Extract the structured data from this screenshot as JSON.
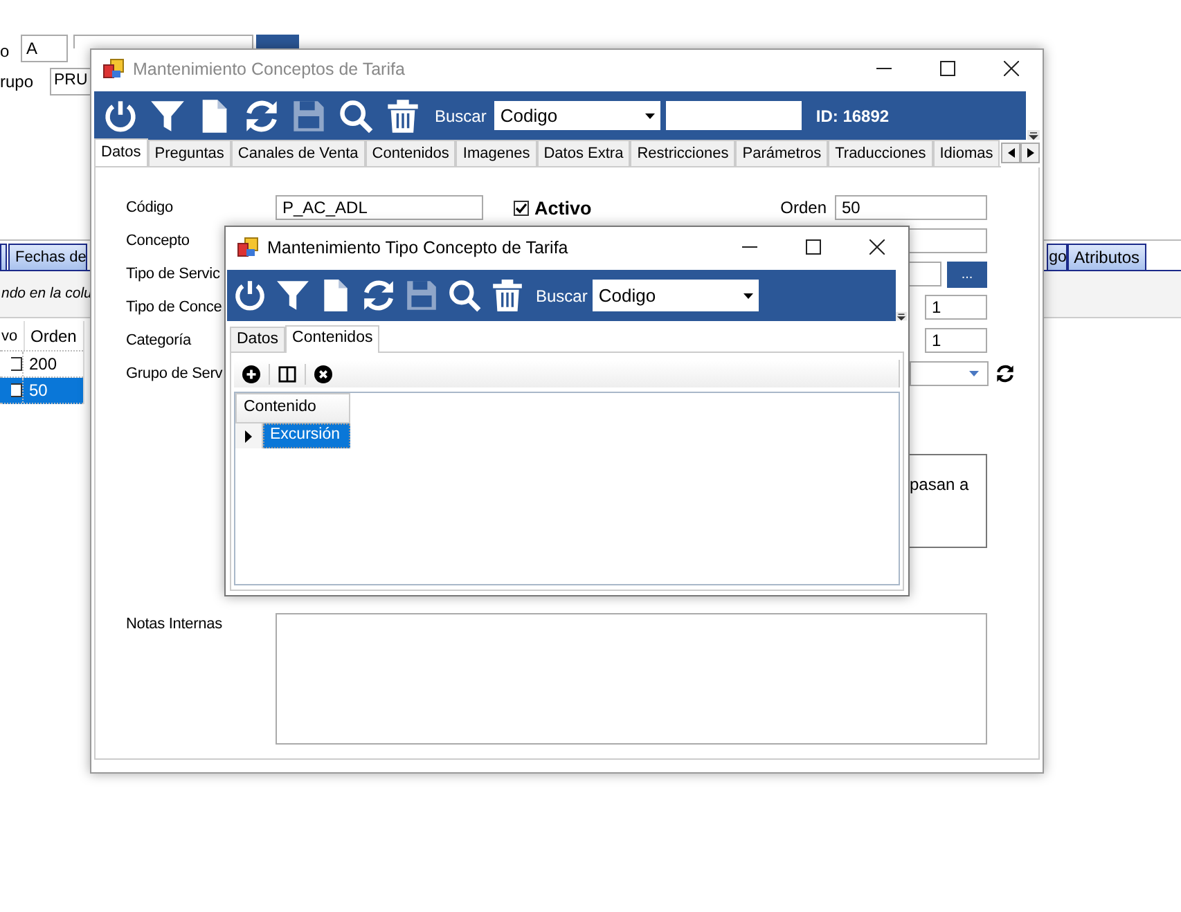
{
  "background_window": {
    "label_1": "o",
    "field_1": "A",
    "label_2": "rupo",
    "field_3": "PRU",
    "tabs_left": [
      {
        "label": "Fechas de",
        "selected": false
      }
    ],
    "tabs_right": [
      {
        "label": "go",
        "selected": false
      },
      {
        "label": "Atributos",
        "selected": false
      }
    ],
    "hint": "ndo en la colu",
    "grid": {
      "columns": [
        "vo",
        "Orden"
      ],
      "rows": [
        {
          "checked": false,
          "orden": "200",
          "selected": false
        },
        {
          "checked": false,
          "orden": "50",
          "selected": true
        }
      ]
    }
  },
  "window_1": {
    "title": "Mantenimiento Conceptos de Tarifa",
    "active": false,
    "toolbar": {
      "buttons": [
        {
          "kind": "power",
          "disabled": false
        },
        {
          "kind": "filter",
          "disabled": false
        },
        {
          "kind": "new",
          "disabled": false
        },
        {
          "kind": "refresh",
          "disabled": false
        },
        {
          "kind": "save",
          "disabled": true
        },
        {
          "kind": "search",
          "disabled": false
        },
        {
          "kind": "delete",
          "disabled": false
        }
      ],
      "search_label": "Buscar",
      "search_by": "Codigo",
      "id_label": "ID: 16892"
    },
    "tabs": [
      {
        "label": "Datos",
        "selected": true
      },
      {
        "label": "Preguntas",
        "selected": false
      },
      {
        "label": "Canales de Venta",
        "selected": false
      },
      {
        "label": "Contenidos",
        "selected": false
      },
      {
        "label": "Imagenes",
        "selected": false
      },
      {
        "label": "Datos Extra",
        "selected": false
      },
      {
        "label": "Restricciones",
        "selected": false
      },
      {
        "label": "Parámetros",
        "selected": false
      },
      {
        "label": "Traducciones",
        "selected": false
      },
      {
        "label": "Idiomas",
        "selected": false
      }
    ],
    "form": {
      "codigo_label": "Código",
      "codigo": "P_AC_ADL",
      "activo": {
        "label": "Activo",
        "checked": true
      },
      "orden_label": "Orden",
      "orden": "50",
      "labels": [
        "Concepto",
        "Tipo de Servic",
        "Tipo de Conce",
        "Categoría",
        "Grupo de Serv"
      ],
      "browse_button": "...",
      "value_1": "1",
      "value_2": "1",
      "note": "pasan a",
      "notas_label": "Notas Internas"
    }
  },
  "window_2": {
    "title": "Mantenimiento Tipo Concepto de Tarifa",
    "active": true,
    "toolbar": {
      "buttons": [
        {
          "kind": "power",
          "disabled": false
        },
        {
          "kind": "filter",
          "disabled": false
        },
        {
          "kind": "new",
          "disabled": false
        },
        {
          "kind": "refresh",
          "disabled": false
        },
        {
          "kind": "save",
          "disabled": true
        },
        {
          "kind": "search",
          "disabled": false
        },
        {
          "kind": "delete",
          "disabled": false
        }
      ],
      "search_label": "Buscar",
      "search_by": "Codigo"
    },
    "tabs": [
      {
        "label": "Datos",
        "selected": false
      },
      {
        "label": "Contenidos",
        "selected": true
      }
    ],
    "grid_tools": [
      {
        "kind": "add"
      },
      {
        "kind": "columns"
      },
      {
        "kind": "remove"
      }
    ],
    "grid": {
      "columns": [
        "Contenido"
      ],
      "rows": [
        {
          "contenido": "Excursión",
          "selected": true
        }
      ]
    }
  }
}
